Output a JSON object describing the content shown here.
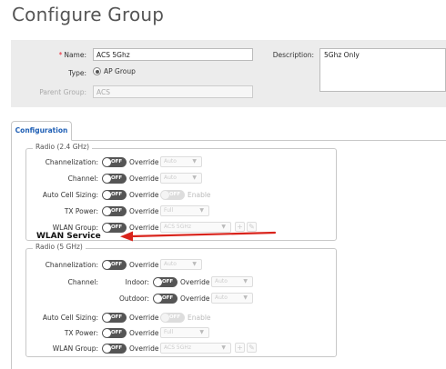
{
  "page": {
    "title": "Configure Group"
  },
  "form": {
    "name_label": "Name:",
    "name_value": "ACS 5Ghz",
    "type_label": "Type:",
    "type_value": "AP Group",
    "parent_label": "Parent Group:",
    "parent_value": "ACS",
    "description_label": "Description:",
    "description_value": "5Ghz Only"
  },
  "tabs": [
    {
      "label": "Configuration",
      "active": true
    }
  ],
  "toggle_off_text": "OFF",
  "override_text": "Override",
  "enable_text": "Enable",
  "radio24": {
    "legend": "Radio (2.4 GHz)",
    "channelization_label": "Channelization:",
    "channelization_value": "Auto",
    "channel_label": "Channel:",
    "channel_value": "Auto",
    "acs_label": "Auto Cell Sizing:",
    "txpower_label": "TX Power:",
    "txpower_value": "Full",
    "wlangroup_label": "WLAN Group:",
    "wlangroup_value": "ACS 5GHz"
  },
  "annotation": {
    "text": "WLAN Service",
    "arrow_color": "#d9241c"
  },
  "radio5": {
    "legend": "Radio (5 GHz)",
    "channelization_label": "Channelization:",
    "channelization_value": "Auto",
    "channel_label": "Channel:",
    "indoor_label": "Indoor:",
    "indoor_value": "Auto",
    "outdoor_label": "Outdoor:",
    "outdoor_value": "Auto",
    "acs_label": "Auto Cell Sizing:",
    "txpower_label": "TX Power:",
    "txpower_value": "Full",
    "wlangroup_label": "WLAN Group:",
    "wlangroup_value": "ACS 5GHz"
  },
  "icons": {
    "add": "plus-icon",
    "edit": "pencil-icon",
    "caret": "caret-down-icon"
  },
  "colors": {
    "toggle_off": "#555555",
    "tab_text": "#1f5fb5",
    "required": "#e22233"
  }
}
